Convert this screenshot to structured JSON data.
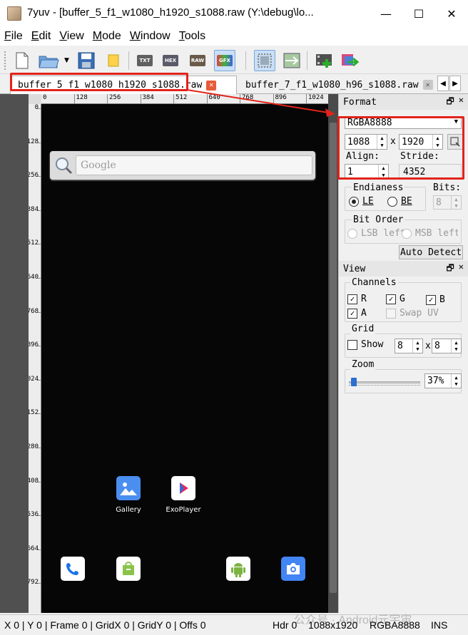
{
  "window": {
    "title": "7yuv - [buffer_5_f1_w1080_h1920_s1088.raw (Y:\\debug\\lo...",
    "minimize": "—",
    "maximize": "☐",
    "close": "✕"
  },
  "menu": {
    "items": [
      "File",
      "Edit",
      "View",
      "Mode",
      "Window",
      "Tools"
    ],
    "mnemonics": [
      "F",
      "E",
      "V",
      "M",
      "W",
      "T"
    ]
  },
  "toolbar": {
    "buttons": [
      "new-file-icon",
      "open-folder-icon",
      "save-icon",
      "note-icon",
      "txt-icon",
      "hex-icon",
      "raw-icon",
      "gfx-icon",
      "select-icon",
      "compare-icon",
      "add-frame-icon",
      "export-icon"
    ],
    "labels": {
      "txt": "TXT",
      "hex": "HEX",
      "raw": "RAW",
      "gfx": "GFX"
    }
  },
  "tabs": [
    {
      "label": "buffer_5_f1_w1080_h1920_s1088.raw",
      "active": true,
      "close": "✕"
    },
    {
      "label": "buffer_7_f1_w1080_h96_s1088.raw",
      "active": false,
      "close": "✕"
    }
  ],
  "tab_nav": {
    "prev": "◀",
    "next": "▶"
  },
  "ruler": {
    "horizontal": [
      "0",
      "128",
      "256",
      "384",
      "512",
      "640",
      "768",
      "896",
      "1024"
    ],
    "vertical": [
      "0",
      "128",
      "256",
      "384",
      "512",
      "640",
      "768",
      "896",
      "1024",
      "1152",
      "1280",
      "1408",
      "1536",
      "1664",
      "1792"
    ]
  },
  "canvas": {
    "search_placeholder": "Google",
    "apps_row1": [
      {
        "label": "Gallery",
        "icon": "gallery-icon"
      },
      {
        "label": "ExoPlayer",
        "icon": "exoplayer-icon"
      }
    ],
    "dock": [
      "phone-icon",
      "store-icon",
      "android-icon",
      "camera-icon"
    ]
  },
  "format_panel": {
    "title": "Format",
    "format_value": "RGBA8888",
    "width": "1088",
    "times": "x",
    "height": "1920",
    "align_label": "Align:",
    "align_value": "1",
    "stride_label": "Stride:",
    "stride_value": "4352",
    "endianness_label": "Endianess",
    "le_label": "LE",
    "be_label": "BE",
    "bits_label": "Bits:",
    "bits_value": "8",
    "bit_order_label": "Bit Order",
    "lsb_label": "LSB left",
    "msb_label": "MSB left",
    "auto_detect": "Auto Detect"
  },
  "view_panel": {
    "title": "View",
    "channels_label": "Channels",
    "r": "R",
    "g": "G",
    "b": "B",
    "a": "A",
    "swap_uv": "Swap UV",
    "grid_label": "Grid",
    "show_label": "Show",
    "grid_x": "8",
    "grid_times": "x",
    "grid_y": "8",
    "zoom_label": "Zoom",
    "zoom_value": "37%",
    "zoom_fraction": 0.03
  },
  "dock_buttons": {
    "float": "🗗",
    "close": "✕"
  },
  "statusbar": {
    "left": "X 0 | Y 0 | Frame 0 | GridX 0 | GridY 0 | Offs 0",
    "hdr": "Hdr 0",
    "size": "1088x1920",
    "format": "RGBA8888",
    "mode": "INS",
    "watermark": "公众号 · Android元宇宙"
  },
  "colors": {
    "highlight": "#e2231a",
    "canvas": "#060606",
    "dock_blue": "#1a73e8"
  }
}
